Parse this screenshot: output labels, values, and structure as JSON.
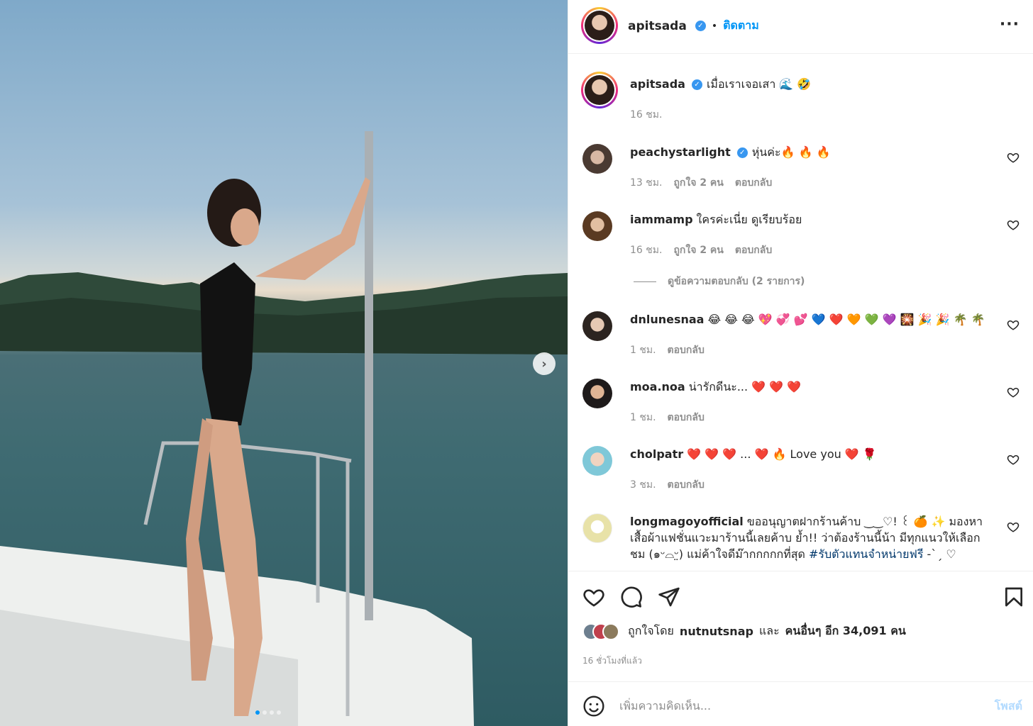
{
  "photo": {
    "next_icon": "chevron-right-icon",
    "dots_count": 4,
    "active_dot": 0
  },
  "header": {
    "username": "apitsada",
    "follow_label": "ติดตาม",
    "separator": "•",
    "more_icon": "more-horizontal-icon"
  },
  "caption": {
    "username": "apitsada",
    "text": "เมื่อเราเจอเสา 🌊 🤣",
    "time": "16 ชม."
  },
  "comments": [
    {
      "username": "peachystarlight",
      "verified": true,
      "text": "หุ่นค่ะ🔥 🔥 🔥",
      "time": "13 ชม.",
      "likes": "ถูกใจ 2 คน",
      "reply": "ตอบกลับ"
    },
    {
      "username": "iammamp",
      "verified": false,
      "text": "ใครค่ะเนี่ย ดูเรียบร้อย",
      "time": "16 ชม.",
      "likes": "ถูกใจ 2 คน",
      "reply": "ตอบกลับ"
    },
    {
      "username": "dnlunesnaa",
      "verified": false,
      "text": "😂 😂 😂 💖 💞 💕 💙 ❤️ 🧡 💚 💜 🎇 🎉 🎉 🌴 🌴",
      "time": "1 ชม.",
      "likes": "",
      "reply": "ตอบกลับ"
    },
    {
      "username": "moa.noa",
      "verified": false,
      "text": "น่ารักดีนะ... ❤️ ❤️ ❤️",
      "time": "1 ชม.",
      "likes": "",
      "reply": "ตอบกลับ"
    },
    {
      "username": "cholpatr",
      "verified": false,
      "text": "❤️ ❤️ ❤️ ... ❤️ 🔥 Love you ❤️ 🌹",
      "time": "3 ชม.",
      "likes": "",
      "reply": "ตอบกลับ"
    },
    {
      "username": "longmagoyofficial",
      "verified": false,
      "text": "ขออนุญาตฝากร้านค้าบ ‿‿♡! ꒰ 🍊 ✨ มองหาเสื้อผ้าแฟชั่นแวะมาร้านนี้เลยค้าบ ย้ำ!! ว่าต้องร้านนี้น้า มีทุกแนวให้เลือกชม (๑ᵕ⌓ᵕ̤) แม่ค้าใจดีม๊ากกกกกที่สุด",
      "hashtag": "#รับตัวแทนจำหน่ายฟรี",
      "tail": " -ˋˏ ♡",
      "time": "",
      "likes": "",
      "reply": ""
    }
  ],
  "view_replies": "ดูข้อความตอบกลับ (2 รายการ)",
  "actions": {
    "like_icon": "heart-icon",
    "comment_icon": "comment-icon",
    "share_icon": "send-icon",
    "save_icon": "bookmark-icon",
    "liked_by_prefix": "ถูกใจโดย",
    "liked_by_user": "nutnutsnap",
    "and_label": "และ",
    "others_label": "คนอื่นๆ อีก 34,091 คน",
    "timestamp": "16 ชั่วโมงที่แล้ว"
  },
  "add_comment": {
    "placeholder": "เพิ่มความคิดเห็น...",
    "post_label": "โพสต์",
    "emoji_icon": "smiley-icon"
  },
  "colors": {
    "link_blue": "#0095f6",
    "verified_blue": "#3897f0",
    "muted": "#8e8e8e",
    "post_disabled": "#b3dbff"
  }
}
